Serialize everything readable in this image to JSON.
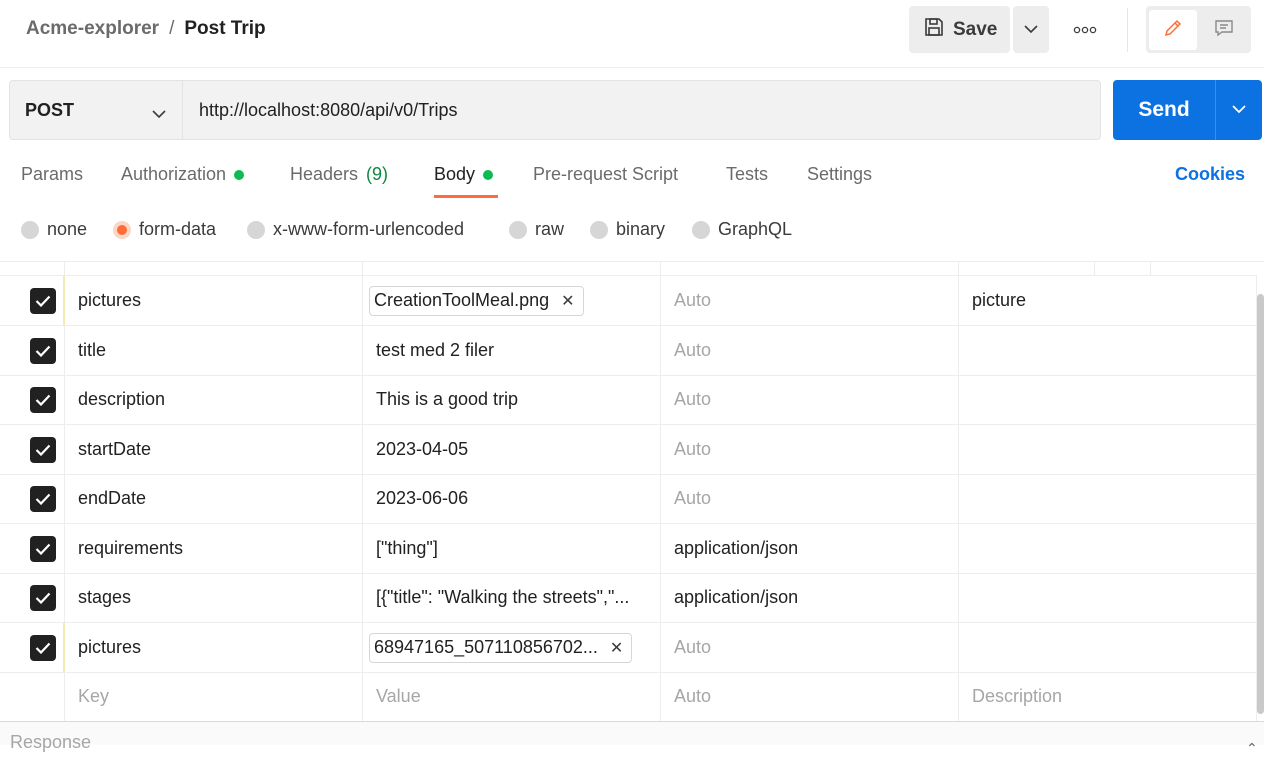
{
  "breadcrumb": {
    "collection": "Acme-explorer",
    "separator": "/",
    "request": "Post Trip"
  },
  "toolbar": {
    "save_label": "Save"
  },
  "request": {
    "method": "POST",
    "url": "http://localhost:8080/api/v0/Trips",
    "send_label": "Send"
  },
  "tabs": [
    {
      "label": "Params"
    },
    {
      "label": "Authorization",
      "dot": true
    },
    {
      "label": "Headers",
      "count": "(9)"
    },
    {
      "label": "Body",
      "dot": true,
      "active": true
    },
    {
      "label": "Pre-request Script"
    },
    {
      "label": "Tests"
    },
    {
      "label": "Settings"
    }
  ],
  "cookies_label": "Cookies",
  "body_types": [
    {
      "label": "none"
    },
    {
      "label": "form-data",
      "selected": true
    },
    {
      "label": "x-www-form-urlencoded"
    },
    {
      "label": "raw"
    },
    {
      "label": "binary"
    },
    {
      "label": "GraphQL"
    }
  ],
  "rows": [
    {
      "key": "pictures",
      "value": "CreationToolMeal.png",
      "file": true,
      "type": "Auto",
      "desc": "picture"
    },
    {
      "key": "title",
      "value": "test med 2 filer",
      "type": "Auto",
      "desc": ""
    },
    {
      "key": "description",
      "value": "This is a good trip",
      "type": "Auto",
      "desc": ""
    },
    {
      "key": "startDate",
      "value": "2023-04-05",
      "type": "Auto",
      "desc": ""
    },
    {
      "key": "endDate",
      "value": "2023-06-06",
      "type": "Auto",
      "desc": ""
    },
    {
      "key": "requirements",
      "value": "[\"thing\"]",
      "type": "application/json",
      "desc": ""
    },
    {
      "key": "stages",
      "value": "[{\"title\": \"Walking the streets\",\"...",
      "type": "application/json",
      "desc": ""
    },
    {
      "key": "pictures",
      "value": "68947165_507110856702...",
      "file": true,
      "type": "Auto",
      "desc": ""
    }
  ],
  "placeholder_row": {
    "key": "Key",
    "value": "Value",
    "type": "Auto",
    "desc": "Description"
  },
  "response_label": "Response",
  "colors": {
    "accent": "#ff6c37",
    "send": "#0c71e1",
    "status_dot": "#0cbb52"
  }
}
